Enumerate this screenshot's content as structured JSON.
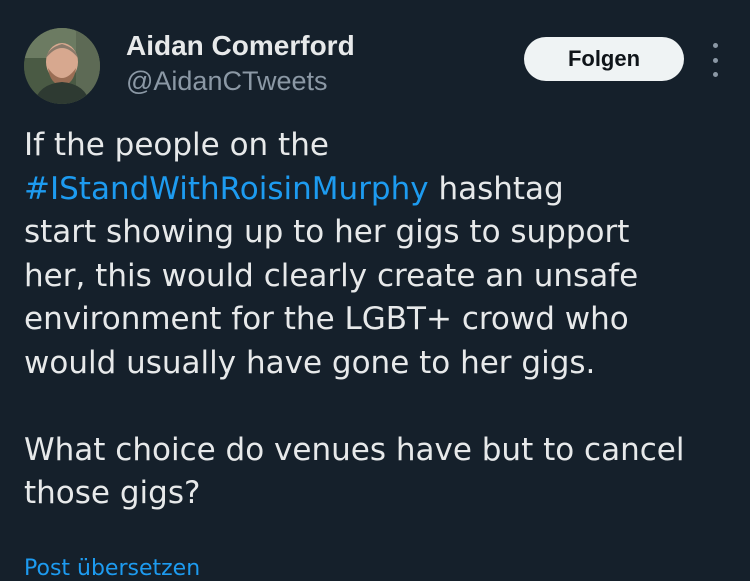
{
  "author": {
    "name": "Aidan Comerford",
    "handle": "@AidanCTweets"
  },
  "follow_label": "Folgen",
  "tweet": {
    "para1": {
      "line1": "If the people on the",
      "hashtag": "#IStandWithRoisinMurphy",
      "line2_rest": " hashtag",
      "line3": "start showing up to her gigs to support",
      "line4": "her, this would clearly create an unsafe",
      "line5": "environment for the LGBT+ crowd who",
      "line6": "would usually have gone to her gigs."
    },
    "para2": {
      "line1": "What choice do venues have but to cancel",
      "line2": "those gigs?"
    }
  },
  "translate_label": "Post übersetzen",
  "colors": {
    "background": "#15202b",
    "text": "#e7e9ea",
    "secondary": "#8b98a5",
    "link": "#1d9bf0",
    "button_bg": "#eff3f4"
  }
}
